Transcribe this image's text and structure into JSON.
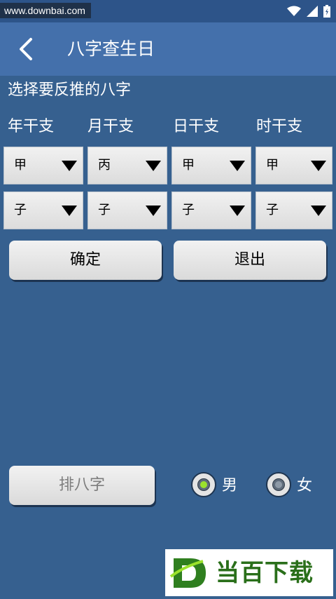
{
  "status_bar": {
    "watermark": "www.downbai.com",
    "icons": [
      "wifi-icon",
      "signal-icon",
      "battery-icon"
    ]
  },
  "app_bar": {
    "back_icon": "chevron-left-icon",
    "title": "八字查生日"
  },
  "form": {
    "prompt": "选择要反推的八字",
    "columns": [
      {
        "label": "年干支",
        "stem": "甲",
        "branch": "子"
      },
      {
        "label": "月干支",
        "stem": "丙",
        "branch": "子"
      },
      {
        "label": "日干支",
        "stem": "甲",
        "branch": "子"
      },
      {
        "label": "时干支",
        "stem": "甲",
        "branch": "子"
      }
    ]
  },
  "actions": {
    "confirm": "确定",
    "exit": "退出"
  },
  "bottom": {
    "paibazi": "排八字",
    "gender_male": "男",
    "gender_female": "女",
    "selected_gender": "男"
  },
  "logo": {
    "text": "当百下载",
    "mark": "D"
  },
  "colors": {
    "background": "#36608f",
    "app_bar": "#4470ab",
    "radio_selected": "#9be22c",
    "logo_green": "#2a6f1a"
  }
}
